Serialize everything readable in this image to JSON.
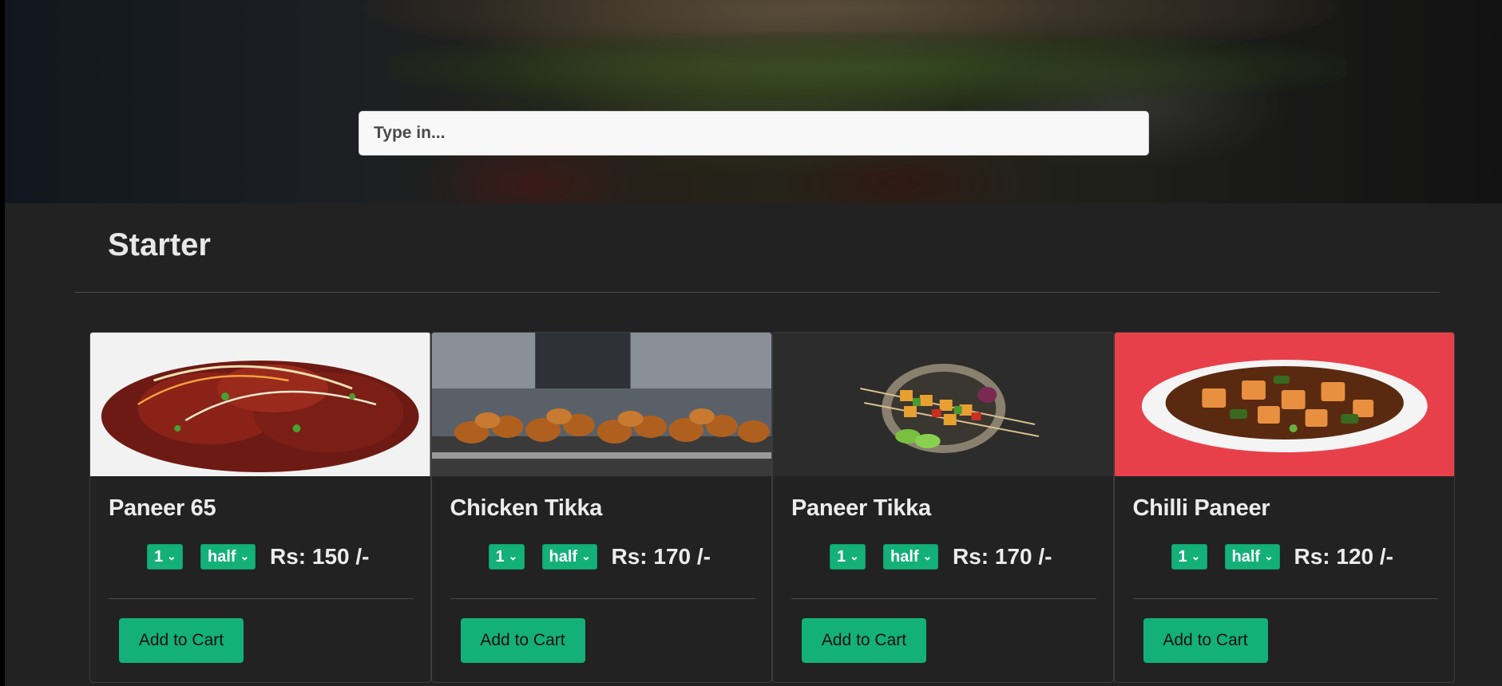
{
  "search": {
    "placeholder": "Type in..."
  },
  "section": {
    "title": "Starter"
  },
  "colors": {
    "accent": "#14b079",
    "background": "#222222",
    "text": "#ececec"
  },
  "items": [
    {
      "name": "Paneer 65",
      "qty": "1",
      "size": "half",
      "price": "Rs: 150 /-",
      "button": "Add to Cart"
    },
    {
      "name": "Chicken Tikka",
      "qty": "1",
      "size": "half",
      "price": "Rs: 170 /-",
      "button": "Add to Cart"
    },
    {
      "name": "Paneer Tikka",
      "qty": "1",
      "size": "half",
      "price": "Rs: 170 /-",
      "button": "Add to Cart"
    },
    {
      "name": "Chilli Paneer",
      "qty": "1",
      "size": "half",
      "price": "Rs: 120 /-",
      "button": "Add to Cart"
    }
  ]
}
